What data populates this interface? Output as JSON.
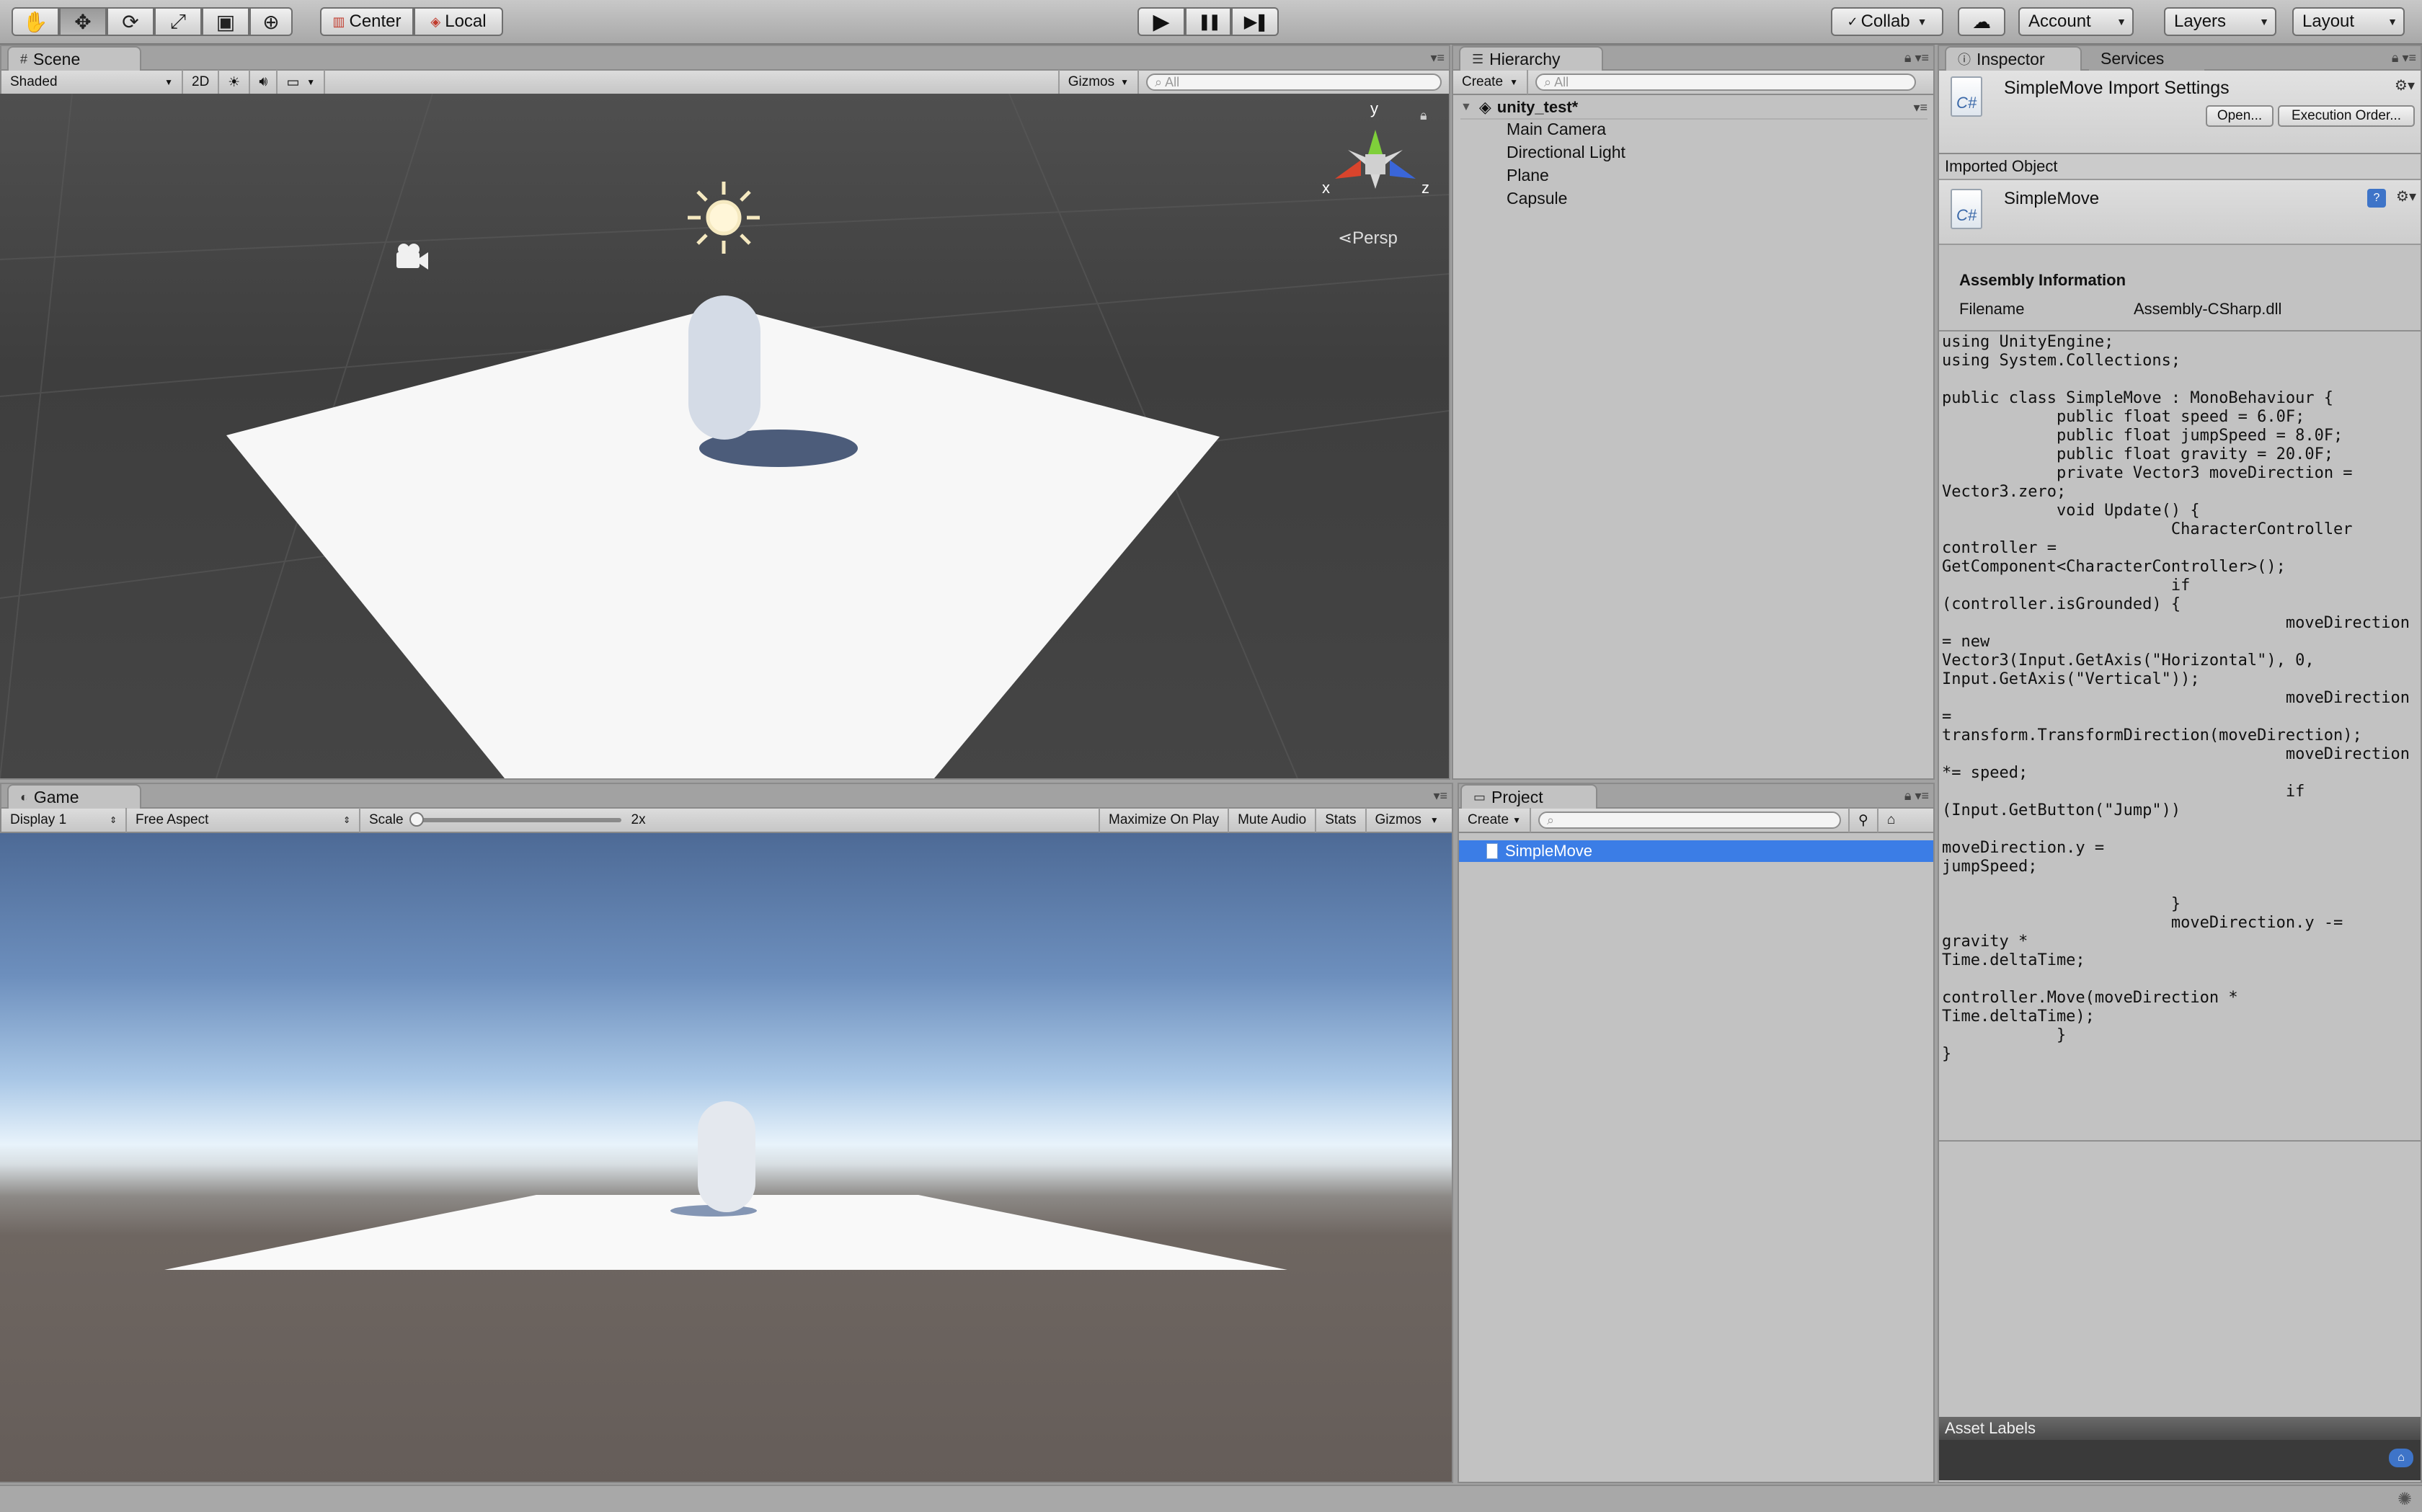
{
  "toolbar": {
    "tools": [
      {
        "icon": "hand-icon",
        "glyph": "✋"
      },
      {
        "icon": "move-icon",
        "glyph": "✥"
      },
      {
        "icon": "rotate-icon",
        "glyph": "⟳"
      },
      {
        "icon": "scale-icon",
        "glyph": "⤢"
      },
      {
        "icon": "rect-icon",
        "glyph": "▣"
      },
      {
        "icon": "transform-icon",
        "glyph": "⊕"
      }
    ],
    "pivot_label": "Center",
    "space_label": "Local",
    "play_glyph": "▶",
    "pause_glyph": "❚❚",
    "step_glyph": "▶❚",
    "collab_label": "Collab",
    "account_label": "Account",
    "layers_label": "Layers",
    "layout_label": "Layout"
  },
  "scene": {
    "tab_label": "Scene",
    "shading_label": "Shaded",
    "mode_2d_label": "2D",
    "gizmos_label": "Gizmos",
    "search_placeholder": "All",
    "persp_label": "Persp",
    "axis_x": "x",
    "axis_y": "y",
    "axis_z": "z"
  },
  "game": {
    "tab_label": "Game",
    "display_label": "Display 1",
    "aspect_label": "Free Aspect",
    "scale_label": "Scale",
    "scale_value": "2x",
    "maximize_label": "Maximize On Play",
    "mute_label": "Mute Audio",
    "stats_label": "Stats",
    "gizmos_label": "Gizmos"
  },
  "hierarchy": {
    "tab_label": "Hierarchy",
    "create_label": "Create",
    "search_placeholder": "All",
    "scene_name": "unity_test*",
    "items": [
      "Main Camera",
      "Directional Light",
      "Plane",
      "Capsule"
    ]
  },
  "project": {
    "tab_label": "Project",
    "create_label": "Create",
    "items": [
      "SimpleMove"
    ]
  },
  "inspector": {
    "tab_label": "Inspector",
    "services_tab_label": "Services",
    "title": "SimpleMove Import Settings",
    "open_button": "Open...",
    "execution_order_button": "Execution Order...",
    "imported_object_label": "Imported Object",
    "asset_name": "SimpleMove",
    "assembly_info_label": "Assembly Information",
    "filename_label": "Filename",
    "filename_value": "Assembly-CSharp.dll",
    "code": "using UnityEngine;\nusing System.Collections;\n\npublic class SimpleMove : MonoBehaviour {\n            public float speed = 6.0F;\n            public float jumpSpeed = 8.0F;\n            public float gravity = 20.0F;\n            private Vector3 moveDirection = Vector3.zero;\n            void Update() {\n                        CharacterController controller =\nGetComponent<CharacterController>();\n                        if (controller.isGrounded) {\n                                    moveDirection = new\nVector3(Input.GetAxis(\"Horizontal\"), 0,\nInput.GetAxis(\"Vertical\"));\n                                    moveDirection =\ntransform.TransformDirection(moveDirection);\n                                    moveDirection *= speed;\n                                    if (Input.GetButton(\"Jump\"))\n                                                moveDirection.y =\njumpSpeed;\n\n                        }\n                        moveDirection.y -= gravity *\nTime.deltaTime;\n                        controller.Move(moveDirection *\nTime.deltaTime);\n            }\n}",
    "asset_labels_label": "Asset Labels",
    "cs_glyph": "C#"
  }
}
